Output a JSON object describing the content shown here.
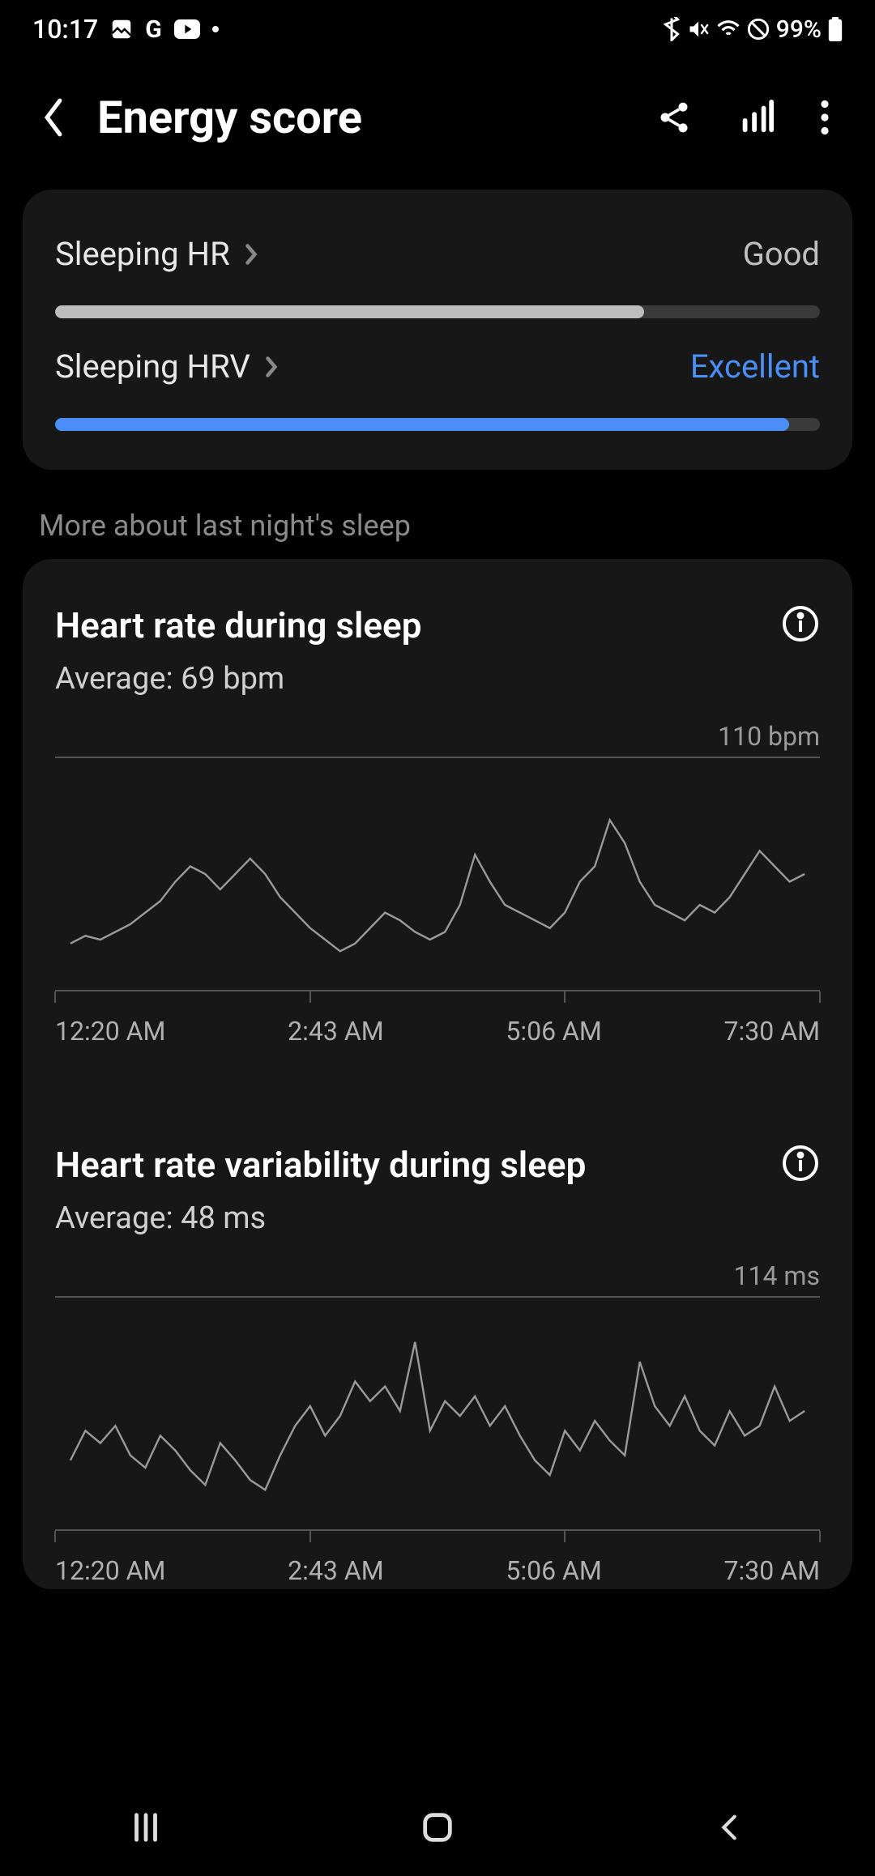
{
  "status": {
    "time": "10:17",
    "battery": "99%"
  },
  "header": {
    "title": "Energy score"
  },
  "metrics": [
    {
      "label": "Sleeping HR",
      "status": "Good",
      "status_class": "status-good",
      "fill_pct": 77,
      "fill_class": "fill-light"
    },
    {
      "label": "Sleeping HRV",
      "status": "Excellent",
      "status_class": "status-excellent",
      "fill_pct": 96,
      "fill_class": "fill-blue"
    }
  ],
  "section_subtitle": "More about last night's sleep",
  "charts": {
    "hr": {
      "title": "Heart rate during sleep",
      "average": "Average: 69 bpm",
      "max_label": "110 bpm",
      "x_ticks": [
        "12:20 AM",
        "2:43 AM",
        "5:06 AM",
        "7:30 AM"
      ]
    },
    "hrv": {
      "title": "Heart rate variability during sleep",
      "average": "Average: 48 ms",
      "max_label": "114 ms",
      "x_ticks": [
        "12:20 AM",
        "2:43 AM",
        "5:06 AM",
        "7:30 AM"
      ]
    }
  },
  "chart_data": [
    {
      "type": "line",
      "title": "Heart rate during sleep",
      "xlabel": "",
      "ylabel": "bpm",
      "ylim": [
        50,
        110
      ],
      "x_ticks": [
        "12:20 AM",
        "2:43 AM",
        "5:06 AM",
        "7:30 AM"
      ],
      "series": [
        {
          "name": "HR",
          "values": [
            62,
            64,
            63,
            65,
            67,
            70,
            73,
            78,
            82,
            80,
            76,
            80,
            84,
            80,
            74,
            70,
            66,
            63,
            60,
            62,
            66,
            70,
            68,
            65,
            63,
            65,
            72,
            85,
            78,
            72,
            70,
            68,
            66,
            70,
            78,
            82,
            94,
            88,
            78,
            72,
            70,
            68,
            72,
            70,
            74,
            80,
            86,
            82,
            78,
            80
          ]
        }
      ]
    },
    {
      "type": "line",
      "title": "Heart rate variability during sleep",
      "xlabel": "",
      "ylabel": "ms",
      "ylim": [
        20,
        114
      ],
      "x_ticks": [
        "12:20 AM",
        "2:43 AM",
        "5:06 AM",
        "7:30 AM"
      ],
      "series": [
        {
          "name": "HRV",
          "values": [
            48,
            60,
            55,
            62,
            50,
            45,
            58,
            52,
            44,
            38,
            55,
            48,
            40,
            36,
            50,
            62,
            70,
            58,
            66,
            80,
            72,
            78,
            68,
            96,
            60,
            72,
            66,
            74,
            62,
            70,
            58,
            48,
            42,
            60,
            52,
            64,
            56,
            50,
            88,
            70,
            62,
            74,
            60,
            54,
            68,
            58,
            62,
            78,
            64,
            68
          ]
        }
      ]
    }
  ]
}
